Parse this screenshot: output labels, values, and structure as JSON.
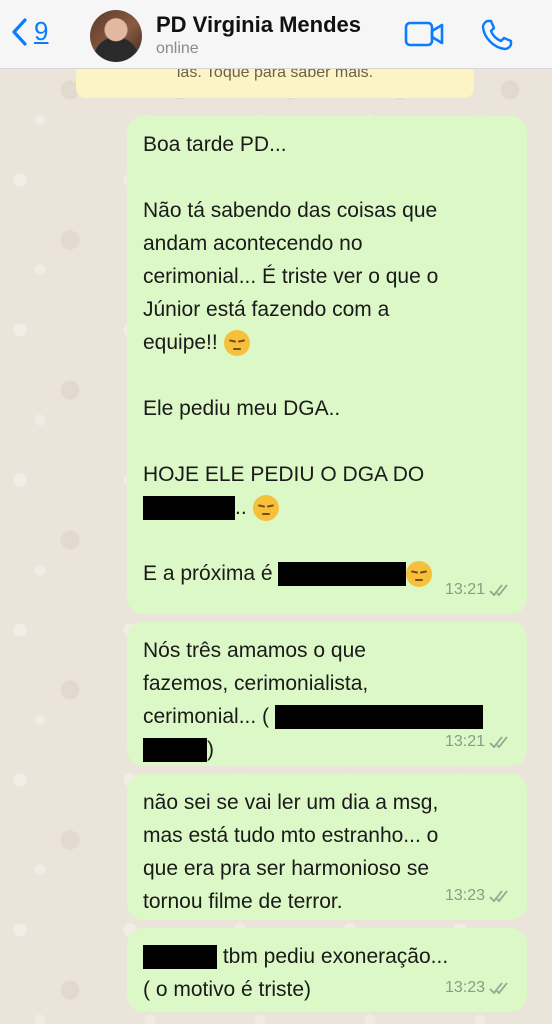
{
  "header": {
    "back_count": "9",
    "contact_name": "PD Virginia Mendes",
    "status": "online"
  },
  "notice": {
    "text": "las. Toque para saber mais."
  },
  "messages": [
    {
      "lines": [
        "Boa tarde PD...",
        "",
        "Não tá sabendo das coisas que",
        "andam acontecendo no",
        "cerimonial... É triste ver o que o",
        "Júnior está fazendo com a",
        "equipe!!",
        "",
        "Ele pediu meu DGA..",
        "",
        "HOJE ELE PEDIU O DGA DO",
        "..",
        "",
        "E a próxima é"
      ],
      "time": "13:21"
    },
    {
      "lines": [
        "Nós três amamos o que",
        "fazemos, cerimonialista,",
        "cerimonial... (",
        ")"
      ],
      "time": "13:21"
    },
    {
      "lines": [
        "não sei se vai ler um dia a msg,",
        "mas está tudo mto estranho... o",
        "que era pra ser harmonioso se",
        "tornou filme de terror."
      ],
      "time": "13:23"
    },
    {
      "lines": [
        "tbm pediu exoneração...",
        "( o motivo é triste)"
      ],
      "time": "13:23"
    }
  ],
  "icons": {
    "back": "chevron-left-icon",
    "video": "video-camera-icon",
    "call": "phone-icon",
    "read_receipt": "double-check-icon",
    "emoji": "sad-face-emoji-icon"
  },
  "colors": {
    "accent": "#0a7cff",
    "bubble": "#dcf8c6",
    "notice": "#fdf4c5"
  }
}
